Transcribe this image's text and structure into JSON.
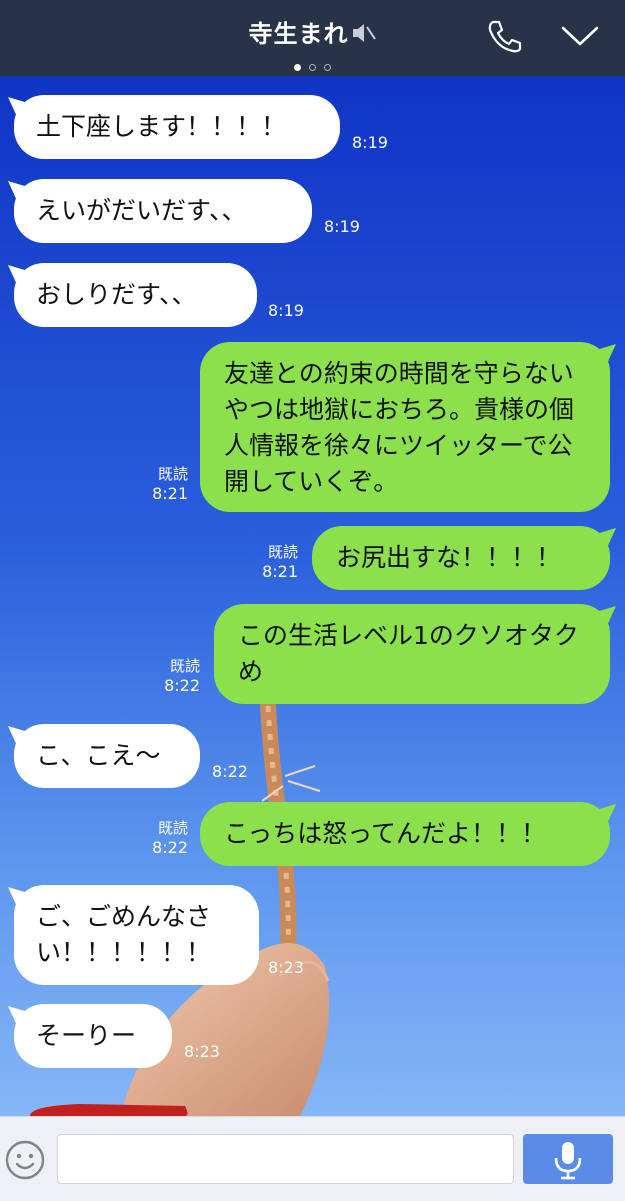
{
  "header": {
    "title": "寺生まれ",
    "muted": true,
    "page_dots": 3,
    "active_dot": 0,
    "icons": [
      "mute-icon",
      "phone-icon",
      "chevron-down-icon"
    ],
    "colors": {
      "bar": "#283347",
      "text": "#ffffff"
    }
  },
  "messages": [
    {
      "dir": "in",
      "text": "土下座します！！！！",
      "time": "8:19"
    },
    {
      "dir": "in",
      "text": "えいがだいだす、、",
      "time": "8:19"
    },
    {
      "dir": "in",
      "text": "おしりだす、、",
      "time": "8:19"
    },
    {
      "dir": "out",
      "text": "友達との約束の時間を守らないやつは地獄におちろ。貴様の個人情報を徐々にツイッターで公開していくぞ。",
      "read": "既読",
      "time": "8:21"
    },
    {
      "dir": "out",
      "text": "お尻出すな！！！！",
      "read": "既読",
      "time": "8:21"
    },
    {
      "dir": "out",
      "text": "この生活レベル1のクソオタクめ",
      "read": "既読",
      "time": "8:22"
    },
    {
      "dir": "in",
      "text": "こ、こえ〜",
      "time": "8:22"
    },
    {
      "dir": "out",
      "text": "こっちは怒ってんだよ！！！",
      "read": "既読",
      "time": "8:22"
    },
    {
      "dir": "in",
      "text": "ご、ごめんなさい！！！！！！",
      "time": "8:23"
    },
    {
      "dir": "in",
      "text": "そーりー",
      "time": "8:23"
    }
  ],
  "composer": {
    "placeholder": "",
    "icons": [
      "emoji-icon",
      "microphone-icon"
    ],
    "colors": {
      "bar": "#eef0f4",
      "mic": "#5b8be9"
    }
  },
  "colors": {
    "incoming_bubble": "#ffffff",
    "outgoing_bubble": "#8be04b",
    "background_top": "#0f34c4",
    "background_bottom": "#86b6f6"
  }
}
